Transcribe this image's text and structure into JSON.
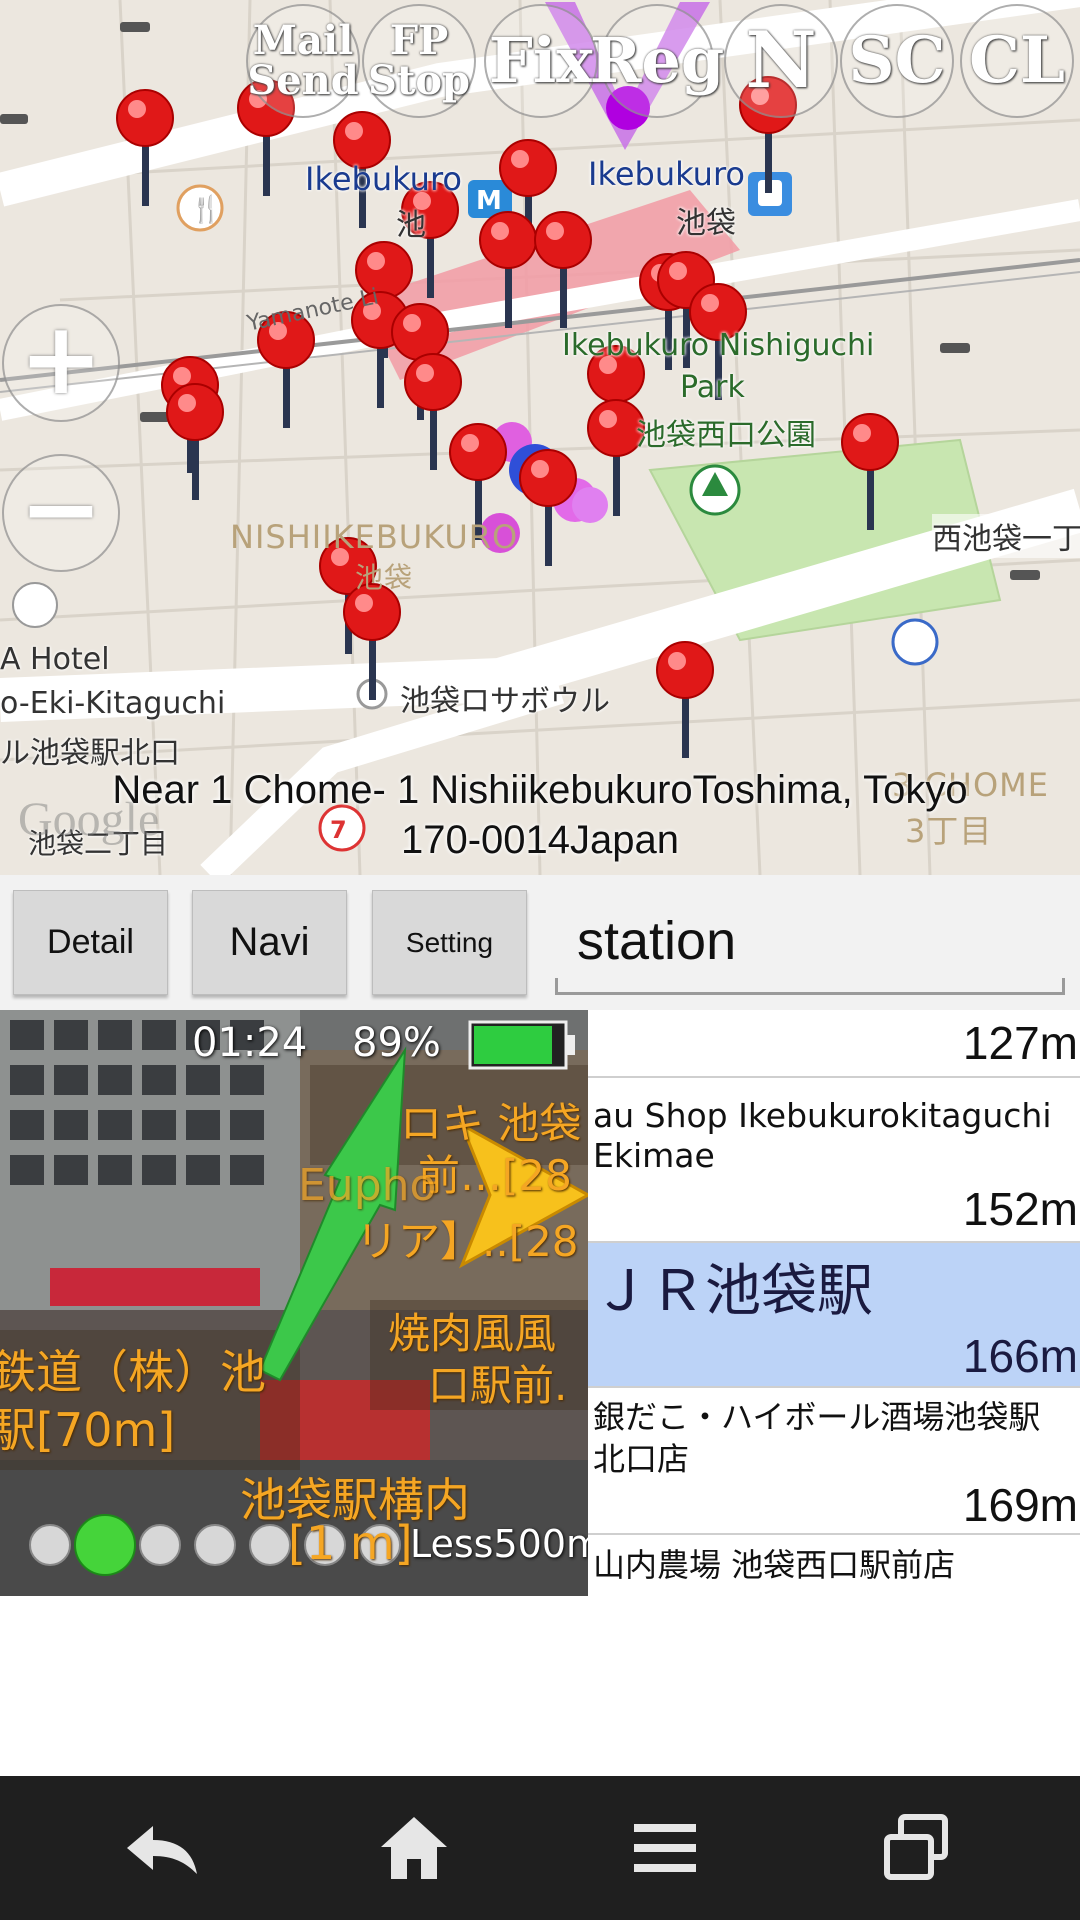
{
  "map": {
    "top_buttons": [
      {
        "label": "Mail\nSend"
      },
      {
        "label": "FP\nStop"
      },
      {
        "label": "Fix"
      },
      {
        "label": "Reg"
      },
      {
        "label": "N"
      },
      {
        "label": "SC"
      },
      {
        "label": "CL"
      }
    ],
    "zoom_in_label": "+",
    "zoom_out_label": "−",
    "labels": {
      "ikebukuro_en_left": "Ikebukuro",
      "ikebukuro_jp_left": "池",
      "ikebukuro_en_right": "Ikebukuro",
      "ikebukuro_jp_right": "池袋",
      "yamanote": "Yamanote Li",
      "park_en": "Ikebukuro Nishiguchi",
      "park_en2": "Park",
      "park_jp": "池袋西口公園",
      "nishiikebukuro": "NISHIIKEBUKURO",
      "nishiikebukuro_jp": "池袋",
      "nishiikebukuro_ichi": "西池袋一丁",
      "hotel1": "A Hotel",
      "hotel2": "o-Eki-Kitaguchi",
      "hotel3": "ル池袋駅北口",
      "sabouru": "池袋ロサボウル",
      "sanchome": "3丁目",
      "sanchome_en": "3 CHOME",
      "nichome": "池袋二丁目",
      "google": "Google"
    },
    "address_line1": "Near 1 Chome- 1  NishiikebukuroToshima, Tokyo",
    "address_line2": "170-0014Japan"
  },
  "toolbar": {
    "detail_label": "Detail",
    "navi_label": "Navi",
    "setting_label": "Setting",
    "search_value": "station"
  },
  "camera": {
    "time": "01:24",
    "battery_percent": "89%",
    "battery_level": 0.89,
    "range_label": "Less500m",
    "page_indicator": {
      "count": 7,
      "active_index": 1
    },
    "overlays": {
      "o1": "ロキ 池袋",
      "o2": "前…[28",
      "o3": "Eupho",
      "o4": "リア】..[28",
      "o5": "焼肉風風",
      "o6": "口駅前.",
      "o7": "鉄道（株）池",
      "o8": "駅[70m]",
      "o9": "池袋駅構内",
      "o10": "[1   m]"
    },
    "colors": {
      "accent_orange": "#f5a623",
      "arrow_green": "#3cc84a"
    }
  },
  "list": {
    "items": [
      {
        "name": "",
        "distance": "127m"
      },
      {
        "name": "au Shop Ikebukurokitaguchi Ekimae",
        "distance": "152m"
      },
      {
        "name": "ＪＲ池袋駅",
        "distance": "166m",
        "selected": true
      },
      {
        "name": "銀だこ・ハイボール酒場池袋駅北口店",
        "distance": "169m"
      },
      {
        "name": "山内農場 池袋西口駅前店",
        "distance": ""
      }
    ],
    "selected_color": "#bcd3f7"
  },
  "navbar": {
    "icons": [
      "back-icon",
      "home-icon",
      "menu-icon",
      "recent-apps-icon"
    ]
  }
}
